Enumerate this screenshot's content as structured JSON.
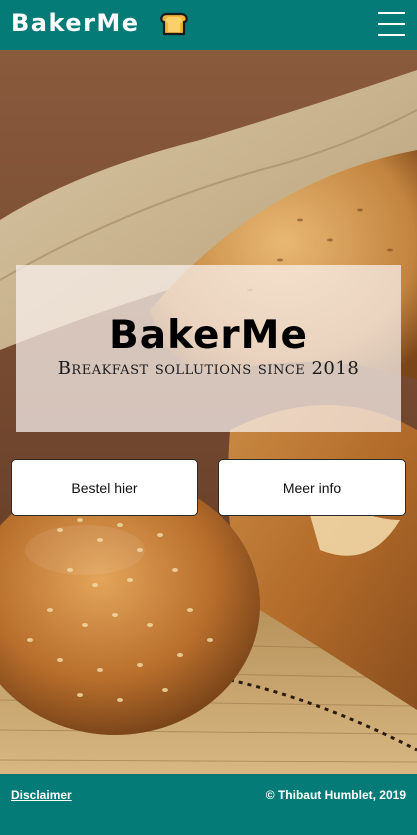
{
  "header": {
    "brand": "BakerMe",
    "brand_icon": "bread-toast-icon",
    "menu_icon": "hamburger-menu-icon"
  },
  "hero": {
    "title": "BakerMe",
    "tagline": "Breakfast sollutions since 2018",
    "buttons": {
      "order_label": "Bestel hier",
      "info_label": "Meer info"
    }
  },
  "footer": {
    "disclaimer_label": "Disclaimer",
    "copyright": "© Thibaut Humblet, 2019"
  },
  "colors": {
    "header_bg": "#047b76",
    "footer_bg": "#047b76",
    "card_overlay": "#f8f0ec"
  }
}
